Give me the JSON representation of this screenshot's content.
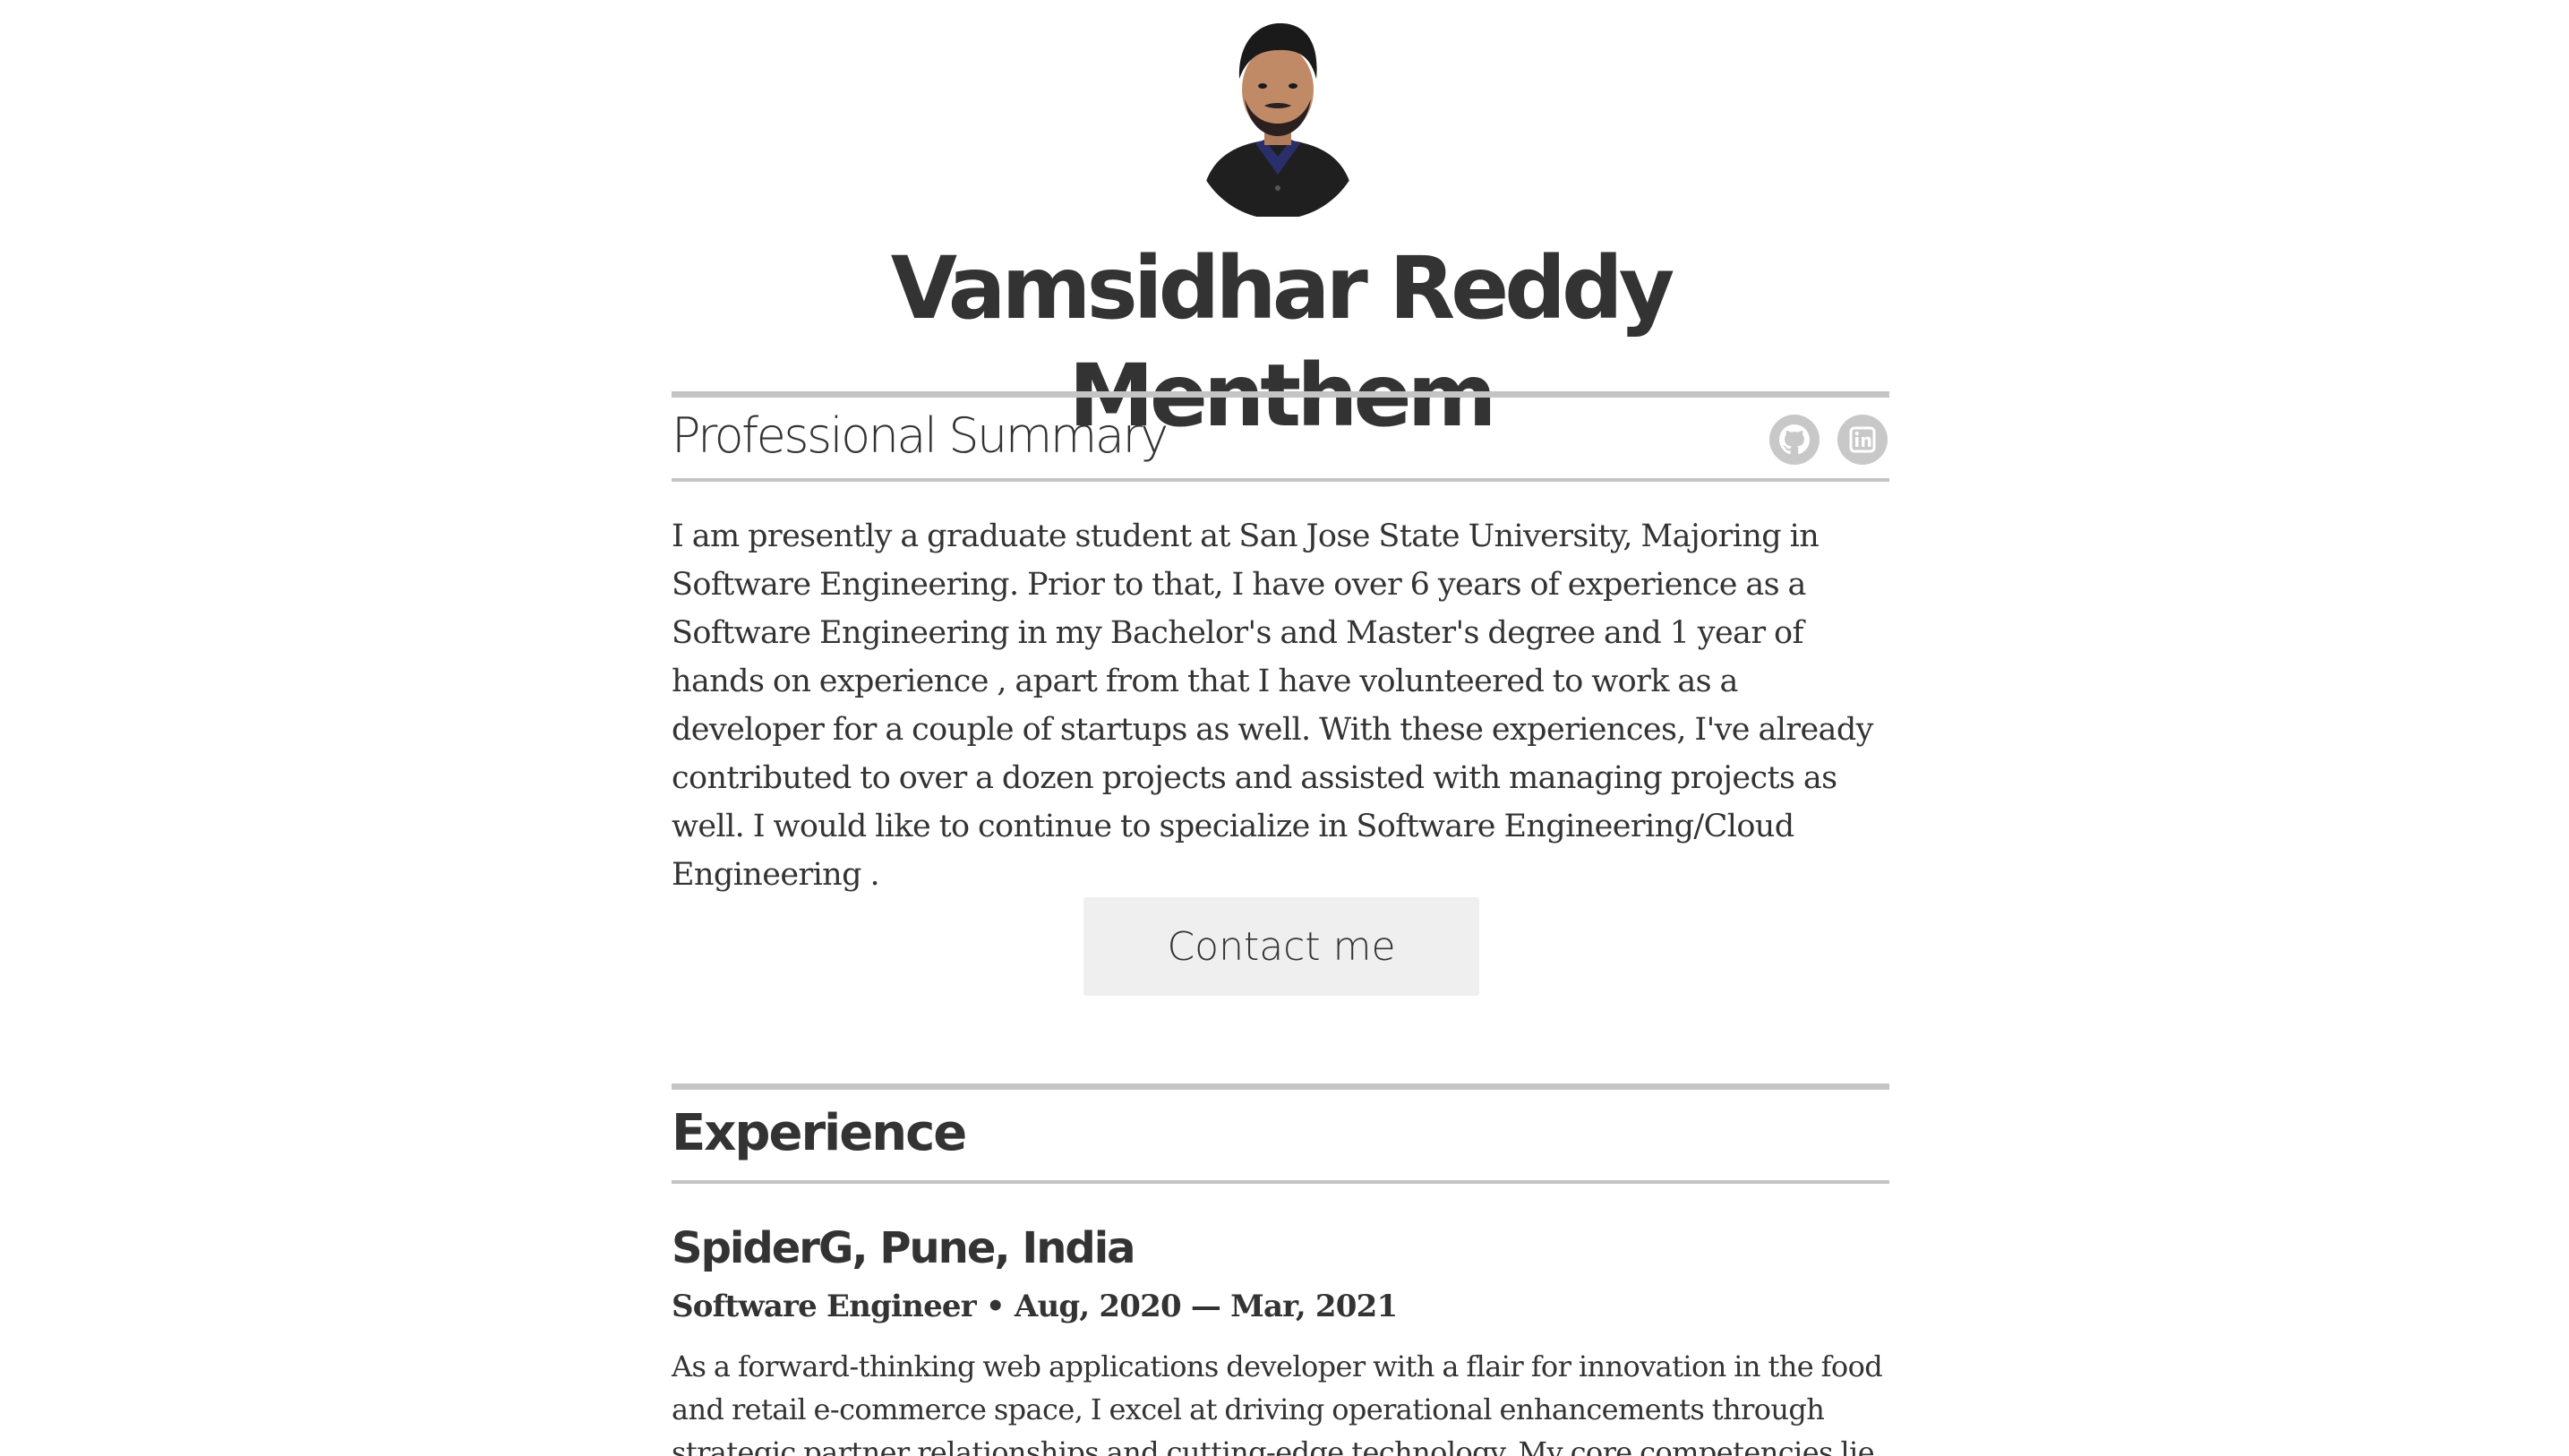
{
  "profile": {
    "name": "Vamsidhar Reddy Menthem",
    "avatar_alt": "Profile photo"
  },
  "summary": {
    "title": "Professional Summary",
    "text": "I am presently a graduate student at San Jose State University, Majoring in Software Engineering. Prior to that, I have over 6 years of experience as a Software Engineering in my Bachelor's and Master's degree and 1 year of hands on experience , apart from that I have volunteered to work as a developer for a couple of startups as well. With these experiences, I've already contributed to over a dozen projects and assisted with managing projects as well. I would like to continue to specialize in Software Engineering/Cloud Engineering .",
    "social": [
      {
        "icon": "github-icon"
      },
      {
        "icon": "linkedin-icon"
      }
    ]
  },
  "contact": {
    "button_label": "Contact me"
  },
  "experience": {
    "title": "Experience",
    "jobs": [
      {
        "company": "SpiderG, Pune, India",
        "role_dates": "Software Engineer • Aug, 2020 — Mar, 2021",
        "description": "As a forward-thinking web applications developer with a flair for innovation in the food and retail e-commerce space, I excel at driving operational enhancements through strategic partner relationships and cutting-edge technology. My core competencies lie in"
      }
    ]
  },
  "colors": {
    "text": "#333333",
    "rule": "#c4c4c4",
    "button_bg": "#efefef",
    "icon_bg": "#c8c8c8"
  }
}
